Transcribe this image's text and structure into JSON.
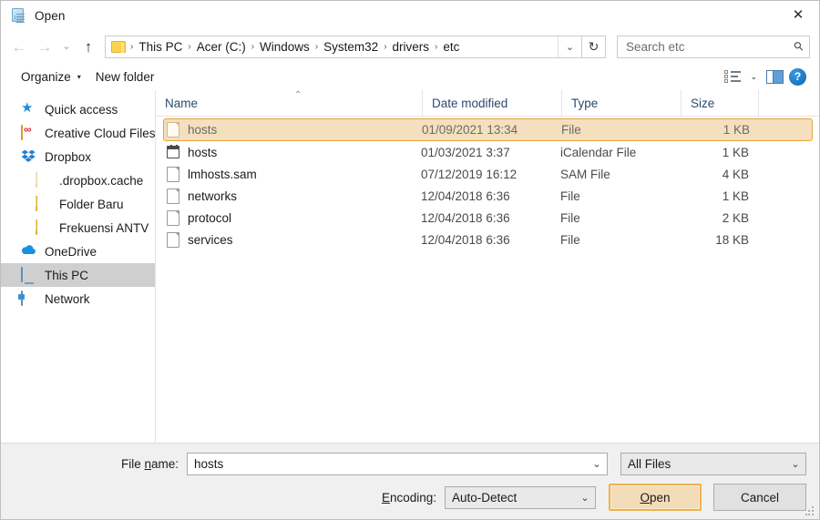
{
  "window": {
    "title": "Open",
    "app_icon": "notepad-icon",
    "close_label": "✕"
  },
  "nav": {
    "back_icon": "←",
    "forward_icon": "→",
    "recent_icon": "⌄",
    "up_icon": "↑",
    "refresh_icon": "↻",
    "address_chevron": "⌄",
    "breadcrumbs": [
      "This PC",
      "Acer (C:)",
      "Windows",
      "System32",
      "drivers",
      "etc"
    ],
    "separator": "›"
  },
  "search": {
    "placeholder": "Search etc",
    "value": "",
    "icon": "search-icon"
  },
  "toolbar": {
    "organize_label": "Organize",
    "organize_caret": "▾",
    "new_folder_label": "New folder",
    "view_caret": "⌄",
    "help_label": "?"
  },
  "sidebar": {
    "items": [
      {
        "label": "Quick access",
        "icon": "star-icon",
        "selected": false,
        "child": false
      },
      {
        "label": "Creative Cloud Files",
        "icon": "creative-cloud-icon",
        "selected": false,
        "child": false
      },
      {
        "label": "Dropbox",
        "icon": "dropbox-icon",
        "selected": false,
        "child": false
      },
      {
        "label": ".dropbox.cache",
        "icon": "folder-pale-icon",
        "selected": false,
        "child": true
      },
      {
        "label": "Folder Baru",
        "icon": "folder-icon",
        "selected": false,
        "child": true
      },
      {
        "label": "Frekuensi ANTV",
        "icon": "folder-icon",
        "selected": false,
        "child": true
      },
      {
        "label": "OneDrive",
        "icon": "cloud-icon",
        "selected": false,
        "child": false
      },
      {
        "label": "This PC",
        "icon": "pc-icon",
        "selected": true,
        "child": false
      },
      {
        "label": "Network",
        "icon": "network-icon",
        "selected": false,
        "child": false
      }
    ]
  },
  "filelist": {
    "sort_caret": "⌃",
    "columns": [
      "Name",
      "Date modified",
      "Type",
      "Size"
    ],
    "rows": [
      {
        "name": "hosts",
        "date": "01/09/2021 13:34",
        "type": "File",
        "size": "1 KB",
        "icon": "file-icon",
        "selected": true
      },
      {
        "name": "hosts",
        "date": "01/03/2021 3:37",
        "type": "iCalendar File",
        "size": "1 KB",
        "icon": "calendar-icon",
        "selected": false
      },
      {
        "name": "lmhosts.sam",
        "date": "07/12/2019 16:12",
        "type": "SAM File",
        "size": "4 KB",
        "icon": "file-icon",
        "selected": false
      },
      {
        "name": "networks",
        "date": "12/04/2018 6:36",
        "type": "File",
        "size": "1 KB",
        "icon": "file-icon",
        "selected": false
      },
      {
        "name": "protocol",
        "date": "12/04/2018 6:36",
        "type": "File",
        "size": "2 KB",
        "icon": "file-icon",
        "selected": false
      },
      {
        "name": "services",
        "date": "12/04/2018 6:36",
        "type": "File",
        "size": "18 KB",
        "icon": "file-icon",
        "selected": false
      }
    ]
  },
  "footer": {
    "filename_label_pre": "File ",
    "filename_label_key": "n",
    "filename_label_post": "ame:",
    "filename_value": "hosts",
    "filter_value": "All Files",
    "encoding_label_key": "E",
    "encoding_label_post": "ncoding:",
    "encoding_value": "Auto-Detect",
    "open_label_key": "O",
    "open_label_post": "pen",
    "cancel_label": "Cancel",
    "dropdown_caret": "⌄"
  },
  "colors": {
    "selection_fill": "#f4dfbe",
    "selection_border": "#e8a33d",
    "primary_button_fill": "#f3dcb8",
    "primary_button_border": "#f0b24c",
    "sidebar_selection": "#cfcfcf",
    "column_header_text": "#2b4a70",
    "footer_bg": "#f0f0f0"
  }
}
